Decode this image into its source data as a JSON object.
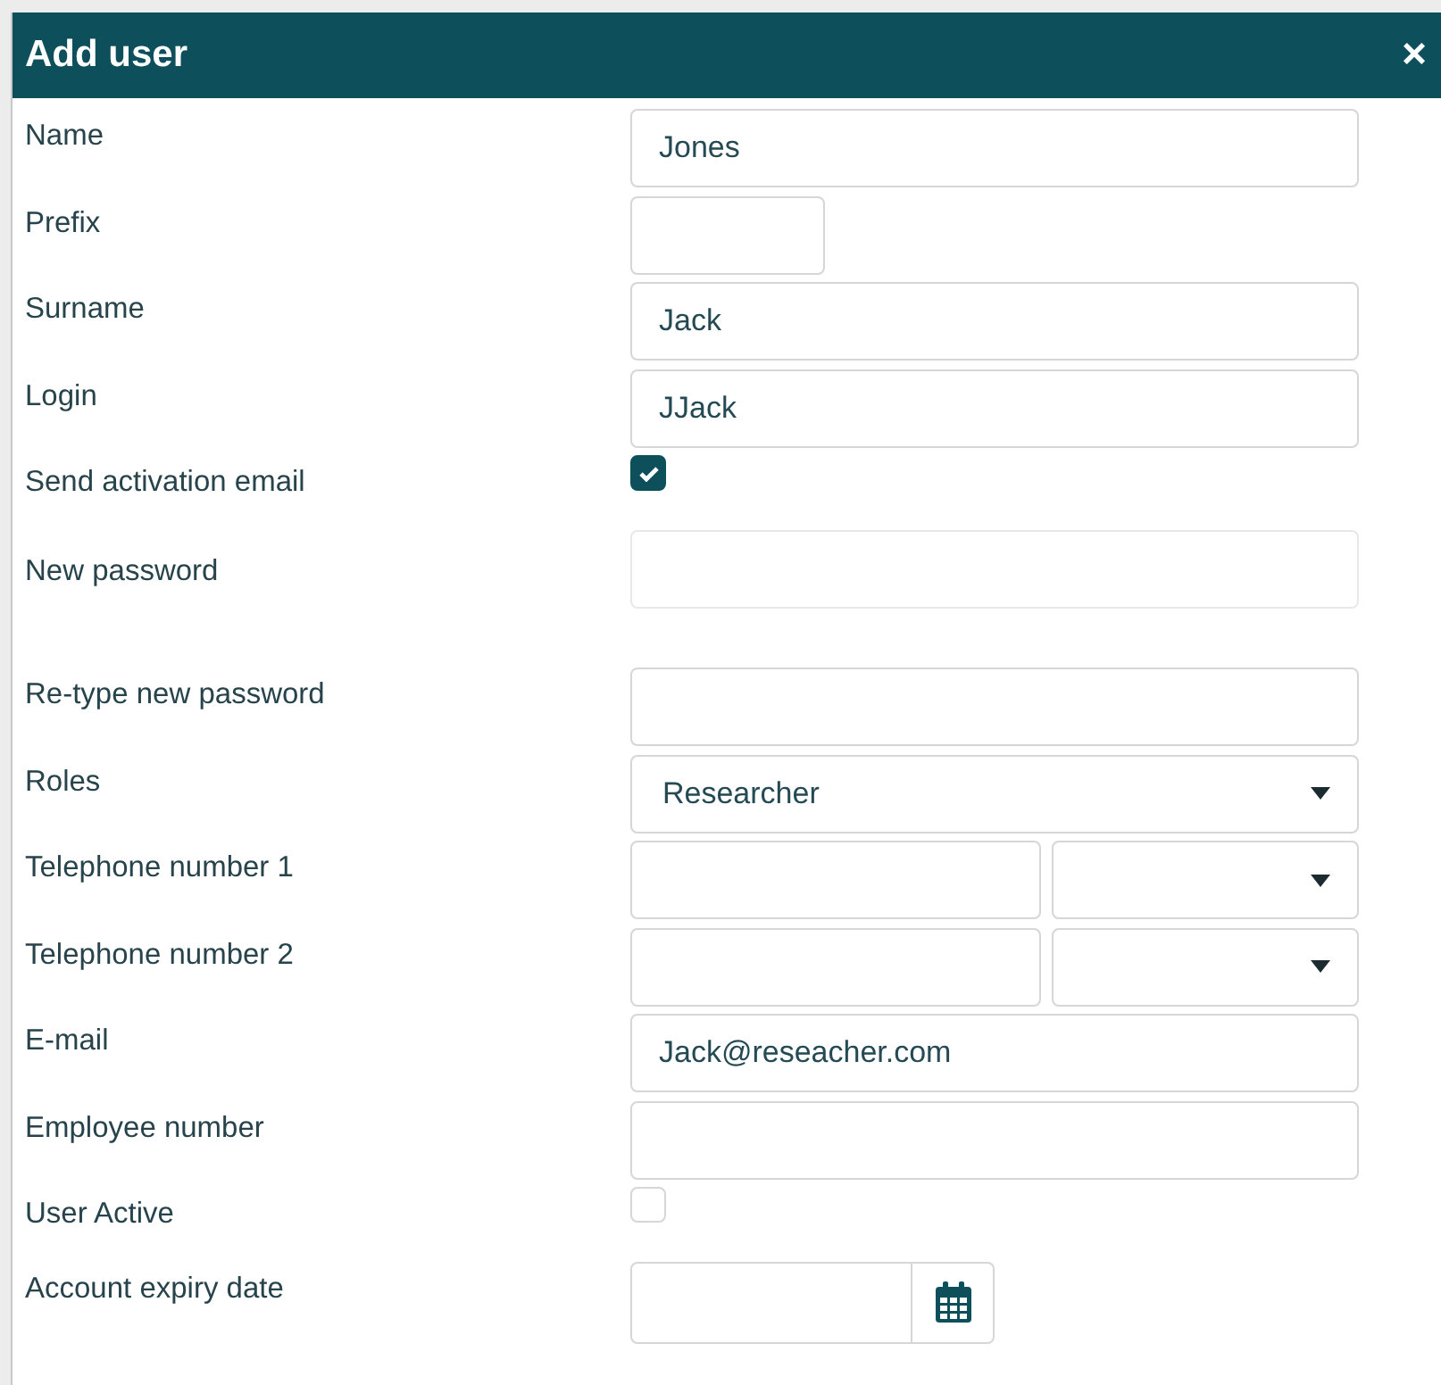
{
  "dialog": {
    "title": "Add user",
    "close": "×"
  },
  "fields": [
    {
      "label": "Name",
      "kind": "text",
      "value": "Jones"
    },
    {
      "label": "Prefix",
      "kind": "short"
    },
    {
      "label": "Surname",
      "kind": "text",
      "value": "Jack"
    },
    {
      "label": "Login",
      "kind": "text",
      "value": "JJack"
    },
    {
      "label": "Send activation email",
      "kind": "checkbox",
      "checked": true
    },
    {
      "label": "New password",
      "kind": "password"
    },
    {
      "label": "Re-type new password",
      "kind": "text"
    },
    {
      "label": "Roles",
      "kind": "select",
      "value": "Researcher"
    },
    {
      "label": "Telephone number 1",
      "kind": "phone"
    },
    {
      "label": "Telephone number 2",
      "kind": "phone"
    },
    {
      "label": "E-mail",
      "kind": "text",
      "value": "Jack@reseacher.com"
    },
    {
      "label": "Employee number",
      "kind": "text"
    },
    {
      "label": "User Active",
      "kind": "checkbox",
      "checked": false
    },
    {
      "label": "Account expiry date",
      "kind": "date"
    }
  ]
}
